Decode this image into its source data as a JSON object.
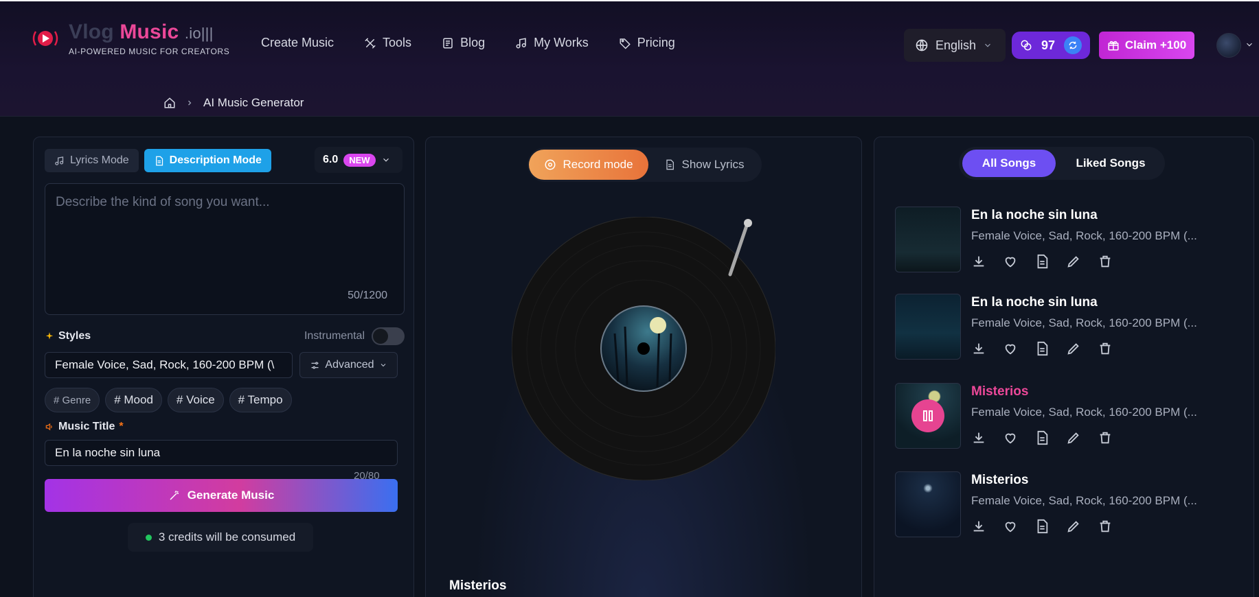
{
  "header": {
    "logo": {
      "vlog": "Vlog",
      "music": "Music",
      "io": ".io",
      "tagline": "AI-POWERED MUSIC FOR CREATORS"
    },
    "nav": [
      {
        "label": "Create Music",
        "icon": "none"
      },
      {
        "label": "Tools",
        "icon": "tools-icon"
      },
      {
        "label": "Blog",
        "icon": "blog-icon"
      },
      {
        "label": "My Works",
        "icon": "music-note-icon"
      },
      {
        "label": "Pricing",
        "icon": "tag-icon"
      }
    ],
    "language": "English",
    "credits": "97",
    "claim_label": "Claim +100"
  },
  "breadcrumb": {
    "current": "AI Music Generator"
  },
  "left": {
    "lyrics_mode": "Lyrics Mode",
    "description_mode": "Description Mode",
    "version": "6.0",
    "new_badge": "NEW",
    "description_placeholder": "Describe the kind of song you want...",
    "description_count": "50/1200",
    "styles_label": "Styles",
    "instrumental_label": "Instrumental",
    "instrumental_on": false,
    "styles_value": "Female Voice, Sad, Rock, 160-200 BPM (\\",
    "advanced_label": "Advanced",
    "tags": [
      "# Genre",
      "# Mood",
      "# Voice",
      "# Tempo"
    ],
    "music_title_label": "Music Title",
    "required_mark": "*",
    "music_title_value": "En la noche sin luna",
    "title_count": "20/80",
    "generate_label": "Generate Music",
    "consume_text": "3 credits will be consumed"
  },
  "middle": {
    "record_mode": "Record mode",
    "show_lyrics": "Show Lyrics",
    "now_playing_title": "Misterios"
  },
  "right": {
    "tabs": {
      "all": "All Songs",
      "liked": "Liked Songs"
    },
    "songs": [
      {
        "title": "En la noche sin luna",
        "tags": "Female Voice, Sad, Rock, 160-200 BPM (...",
        "playing": false
      },
      {
        "title": "En la noche sin luna",
        "tags": "Female Voice, Sad, Rock, 160-200 BPM (...",
        "playing": false
      },
      {
        "title": "Misterios",
        "tags": "Female Voice, Sad, Rock, 160-200 BPM (...",
        "playing": true
      },
      {
        "title": "Misterios",
        "tags": "Female Voice, Sad, Rock, 160-200 BPM (...",
        "playing": false
      }
    ]
  },
  "colors": {
    "accent_pink": "#ec4899",
    "accent_purple": "#6d4ff2",
    "accent_blue": "#1ea1e8",
    "record_orange": "#e8733a"
  }
}
